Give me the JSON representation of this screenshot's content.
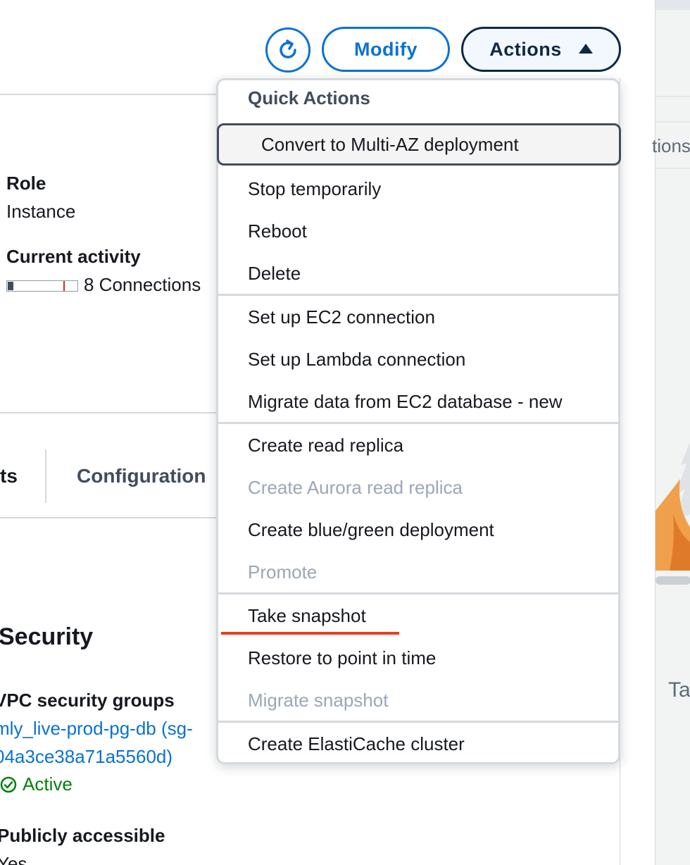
{
  "header": {
    "modify_label": "Modify",
    "actions_label": "Actions"
  },
  "summary": {
    "role_label": "Role",
    "role_value": "Instance",
    "activity_label": "Current activity",
    "activity_value": "8 Connections",
    "activity_level": 0.08
  },
  "tabs": {
    "partial_left": "ts",
    "configuration": "Configuration"
  },
  "security": {
    "title": "Security",
    "vpc_label": "VPC security groups",
    "vpc_link_line1": "mly_live-prod-pg-db (sg-",
    "vpc_link_line2": "04a3ce38a71a5560d)",
    "status": "Active",
    "public_label": "Publicly accessible",
    "public_value": "Yes"
  },
  "side_panel": {
    "tab_fragment": "tions",
    "text_fragment": "Ta"
  },
  "menu": {
    "header": "Quick Actions",
    "items": [
      {
        "label": "Convert to Multi-AZ deployment",
        "state": "highlighted"
      },
      {
        "label": "Stop temporarily",
        "state": "enabled"
      },
      {
        "label": "Reboot",
        "state": "enabled"
      },
      {
        "label": "Delete",
        "state": "enabled"
      },
      {
        "label": "Set up EC2 connection",
        "state": "enabled"
      },
      {
        "label": "Set up Lambda connection",
        "state": "enabled"
      },
      {
        "label": "Migrate data from EC2 database - new",
        "state": "enabled"
      },
      {
        "label": "Create read replica",
        "state": "enabled"
      },
      {
        "label": "Create Aurora read replica",
        "state": "disabled"
      },
      {
        "label": "Create blue/green deployment",
        "state": "enabled"
      },
      {
        "label": "Promote",
        "state": "disabled"
      },
      {
        "label": "Take snapshot",
        "state": "enabled"
      },
      {
        "label": "Restore to point in time",
        "state": "enabled"
      },
      {
        "label": "Migrate snapshot",
        "state": "disabled"
      },
      {
        "label": "Create ElastiCache cluster",
        "state": "enabled"
      }
    ]
  },
  "colors": {
    "primary_blue": "#0972d3",
    "dark_navy": "#0f2847",
    "success_green": "#037f0c",
    "disabled_text": "#9ba7b6",
    "annotation_red": "#ec3e1b"
  }
}
